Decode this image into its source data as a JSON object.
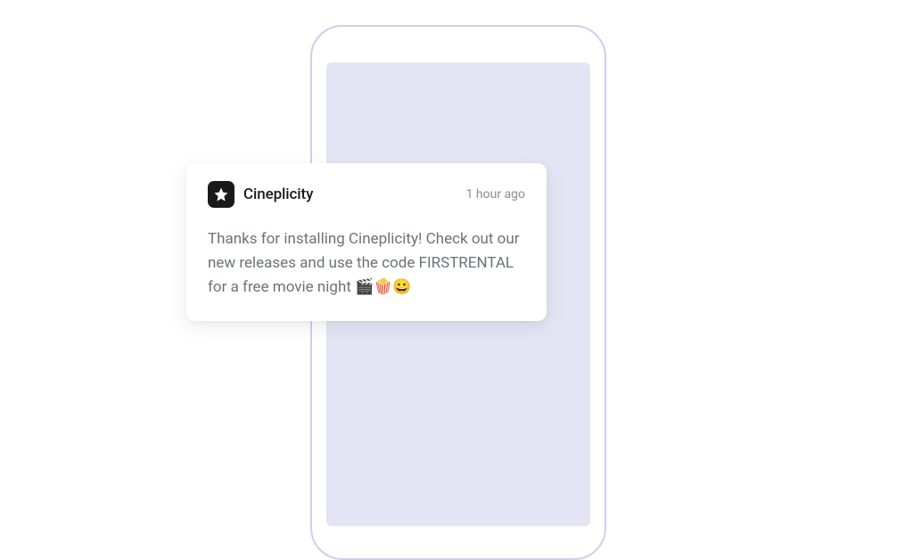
{
  "notification": {
    "app_name": "Cineplicity",
    "icon": "star-icon",
    "timestamp": "1 hour ago",
    "message": "Thanks for installing Cineplicity! Check out our new releases and use the code FIRSTRENTAL for a free movie night 🎬🍿😀"
  }
}
